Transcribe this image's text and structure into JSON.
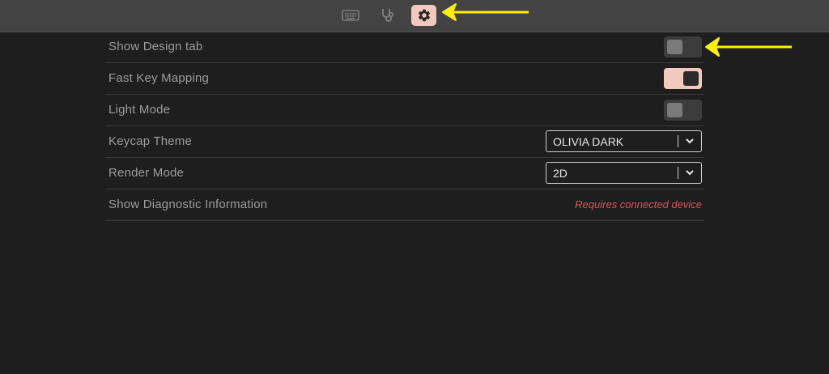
{
  "top_tabs": [
    {
      "name": "keyboard-icon",
      "active": false
    },
    {
      "name": "stethoscope-icon",
      "active": false
    },
    {
      "name": "gear-icon",
      "active": true
    }
  ],
  "settings": [
    {
      "label": "Show Design tab",
      "control": "toggle",
      "value": false
    },
    {
      "label": "Fast Key Mapping",
      "control": "toggle",
      "value": true
    },
    {
      "label": "Light Mode",
      "control": "toggle",
      "value": false
    },
    {
      "label": "Keycap Theme",
      "control": "select",
      "value": "OLIVIA DARK"
    },
    {
      "label": "Render Mode",
      "control": "select",
      "value": "2D"
    },
    {
      "label": "Show Diagnostic Information",
      "control": "status",
      "value": "Requires connected device"
    }
  ],
  "colors": {
    "accent": "#f1c9bf",
    "warning": "#d9535c",
    "annotation": "#ffef00",
    "background": "#1f1e1e",
    "topbar": "#434343"
  }
}
